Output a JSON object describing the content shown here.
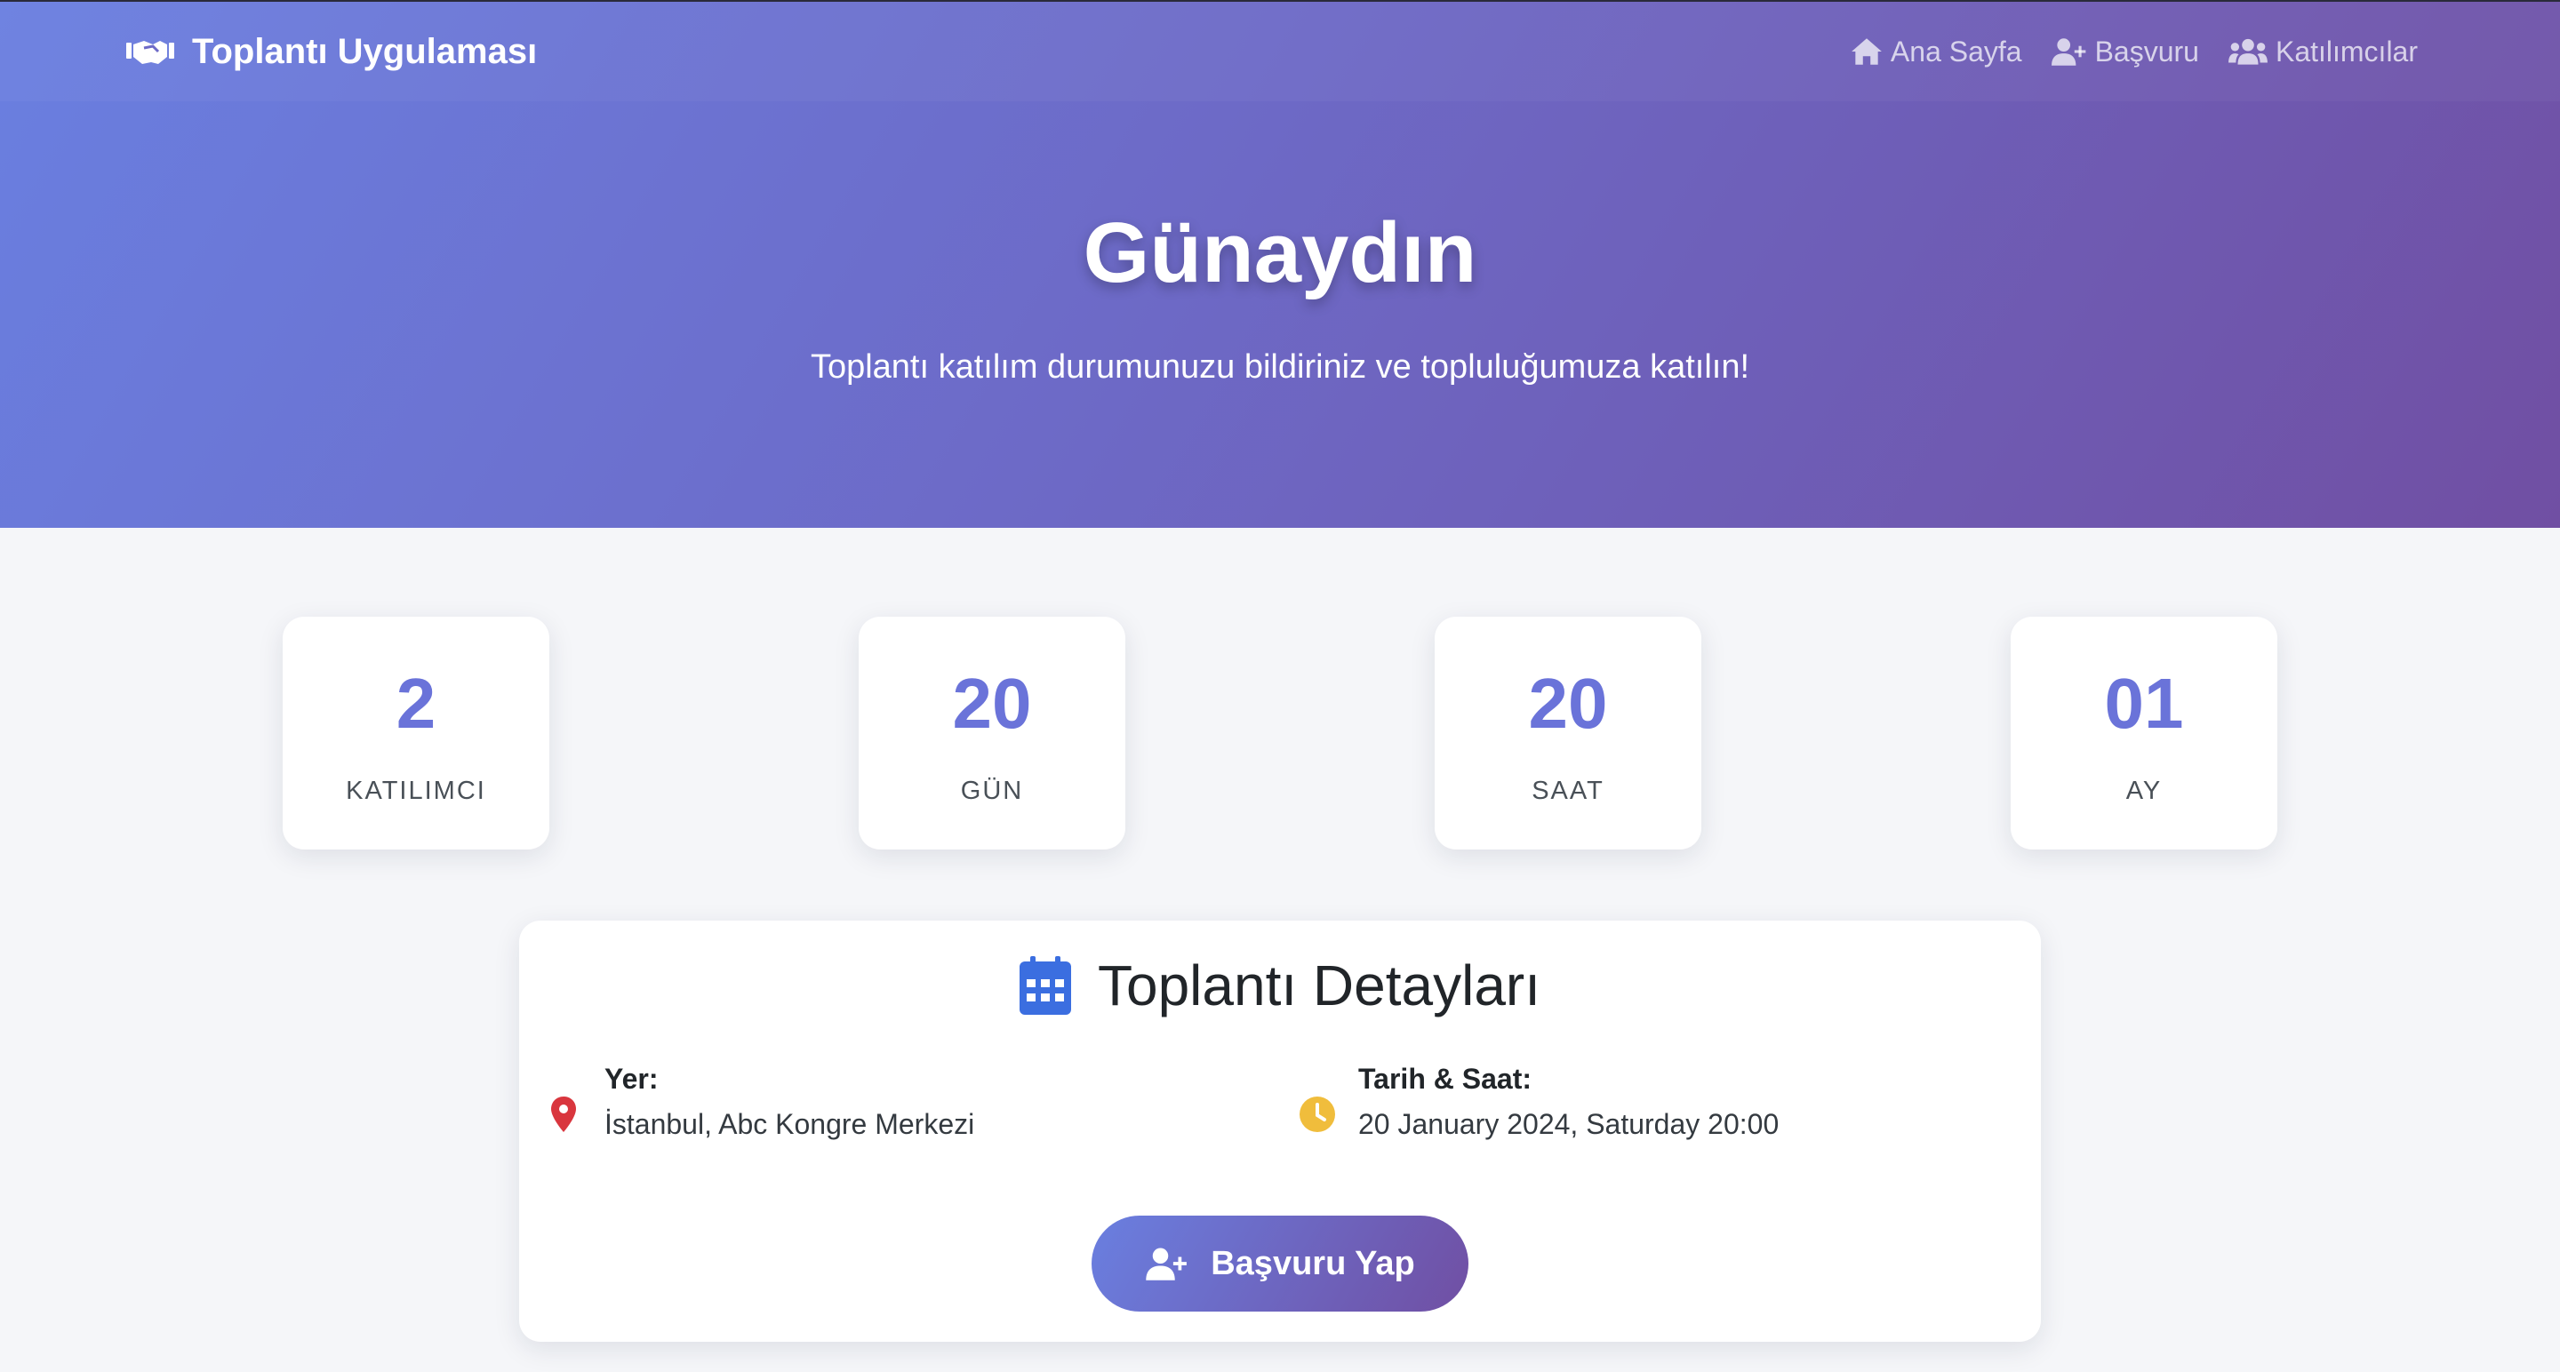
{
  "navbar": {
    "brand": "Toplantı Uygulaması",
    "brand_icon": "handshake-icon",
    "links": [
      {
        "label": "Ana Sayfa",
        "icon": "home-icon"
      },
      {
        "label": "Başvuru",
        "icon": "user-plus-icon"
      },
      {
        "label": "Katılımcılar",
        "icon": "users-icon"
      }
    ]
  },
  "hero": {
    "title": "Günaydın",
    "subtitle": "Toplantı katılım durumunuzu bildiriniz ve topluluğumuza katılın!"
  },
  "stats": [
    {
      "value": "2",
      "label": "KATILIMCI"
    },
    {
      "value": "20",
      "label": "GÜN"
    },
    {
      "value": "20",
      "label": "SAAT"
    },
    {
      "value": "01",
      "label": "AY"
    }
  ],
  "details": {
    "title": "Toplantı Detayları",
    "title_icon": "calendar-icon",
    "location": {
      "label": "Yer:",
      "value": "İstanbul, Abc Kongre Merkezi",
      "icon": "map-pin-icon"
    },
    "datetime": {
      "label": "Tarih & Saat:",
      "value": "20 January 2024, Saturday 20:00",
      "icon": "clock-icon"
    },
    "apply_button": "Başvuru Yap"
  },
  "colors": {
    "gradient_start": "#6a7fe0",
    "gradient_end": "#704fa3",
    "stat_value": "#6a73d9",
    "calendar_icon": "#3b6ee0",
    "pin_icon": "#d9363e",
    "clock_icon": "#f0bd3c"
  }
}
